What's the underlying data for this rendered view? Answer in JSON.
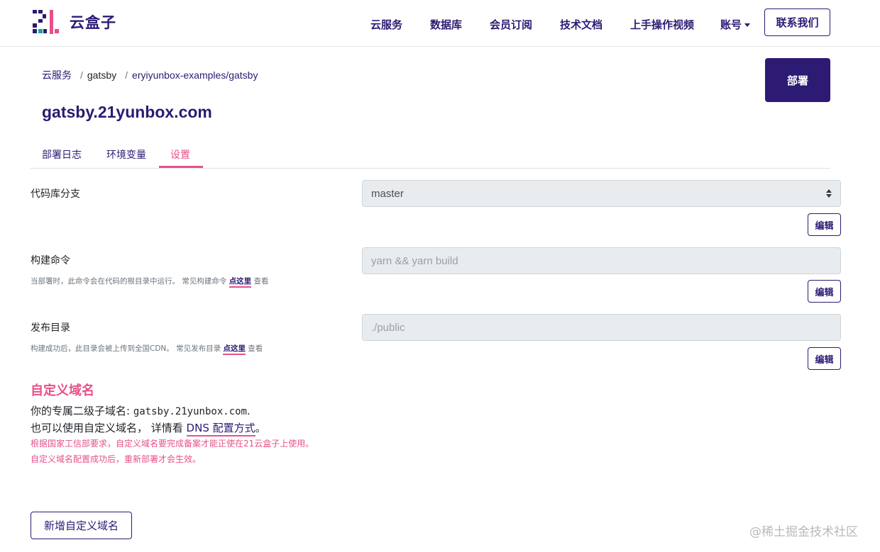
{
  "header": {
    "brand": "云盒子",
    "nav": [
      {
        "label": "云服务"
      },
      {
        "label": "数据库"
      },
      {
        "label": "会员订阅"
      },
      {
        "label": "技术文档"
      },
      {
        "label": "上手操作视频"
      },
      {
        "label": "账号"
      }
    ],
    "contact_label": "联系我们",
    "colors": {
      "brand": "#2d1a73",
      "accent": "#e7508a"
    }
  },
  "breadcrumb": [
    "云服务",
    "gatsby",
    "eryiyunbox-examples/gatsby"
  ],
  "page_title": "gatsby.21yunbox.com",
  "deploy_label": "部署",
  "tabs": [
    {
      "label": "部署日志",
      "active": false
    },
    {
      "label": "环境变量",
      "active": false
    },
    {
      "label": "设置",
      "active": true
    }
  ],
  "settings": {
    "branch": {
      "label": "代码库分支",
      "value": "master",
      "edit_label": "编辑"
    },
    "build": {
      "label": "构建命令",
      "help_prefix": "当部署时，此命令会在代码的根目录中运行。 常见构建命令",
      "help_link": "点这里",
      "help_suffix": "查看",
      "placeholder": "yarn && yarn build",
      "edit_label": "编辑"
    },
    "publish": {
      "label": "发布目录",
      "help_prefix": "构建成功后，此目录会被上传到全国CDN。 常见发布目录",
      "help_link": "点这里",
      "help_suffix": "查看",
      "placeholder": "./public",
      "edit_label": "编辑"
    }
  },
  "custom_domain": {
    "title": "自定义域名",
    "line1_prefix": "你的专属二级子域名: ",
    "subdomain": "gatsby.21yunbox.com",
    "line1_suffix": ".",
    "line2_prefix": "也可以使用自定义域名， 详情看 ",
    "dns_link": "DNS 配置方式",
    "line2_suffix": "。",
    "warn1": "根据国家工信部要求，自定义域名要完成备案才能正使在21云盒子上使用。",
    "warn2": "自定义域名配置成功后，重新部署才会生效。",
    "add_label": "新增自定义域名"
  },
  "watermark": "@稀土掘金技术社区"
}
